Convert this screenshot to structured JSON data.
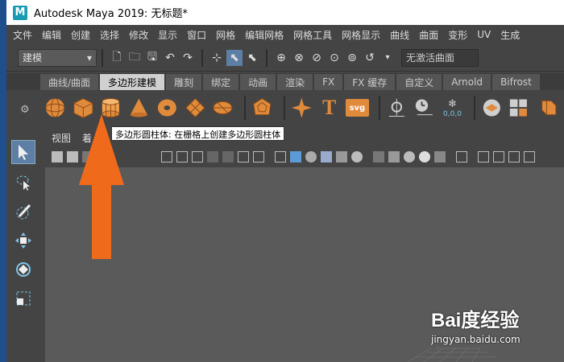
{
  "window": {
    "title": "Autodesk Maya 2019: 无标题*",
    "logo": "M"
  },
  "menubar": [
    "文件",
    "编辑",
    "创建",
    "选择",
    "修改",
    "显示",
    "窗口",
    "网格",
    "编辑网格",
    "网格工具",
    "网格显示",
    "曲线",
    "曲面",
    "变形",
    "UV",
    "生成"
  ],
  "toolbar": {
    "mode": "建模",
    "inactive_surface": "无激活曲面"
  },
  "shelf": {
    "tabs": [
      "曲线/曲面",
      "多边形建模",
      "雕刻",
      "绑定",
      "动画",
      "渲染",
      "FX",
      "FX 缓存",
      "自定义",
      "Arnold",
      "Bifrost"
    ],
    "active_tab": "多边形建模",
    "icons": [
      "poly-sphere-icon",
      "poly-cube-icon",
      "poly-cylinder-icon",
      "poly-cone-icon",
      "poly-torus-icon",
      "poly-plane-icon",
      "poly-disc-icon",
      "platonic-solid-icon",
      "sweep-star-icon",
      "text-icon",
      "svg-icon",
      "target-icon",
      "clock-icon",
      "uv-icon",
      "combine-icon",
      "separate-icon",
      "extract-icon"
    ],
    "svg_label": "svg",
    "text_label": "T",
    "uv_label": "0,0,0"
  },
  "tooltip": "多边形圆柱体: 在栅格上创建多边形圆柱体",
  "panel": {
    "menus": [
      "视图",
      "着"
    ]
  },
  "watermark": {
    "brand": "Bai度经验",
    "url": "jingyan.baidu.com"
  },
  "colors": {
    "accent": "#e87530",
    "arrow": "#f06a1c",
    "background": "#444444",
    "viewport": "#5a5a5a"
  }
}
